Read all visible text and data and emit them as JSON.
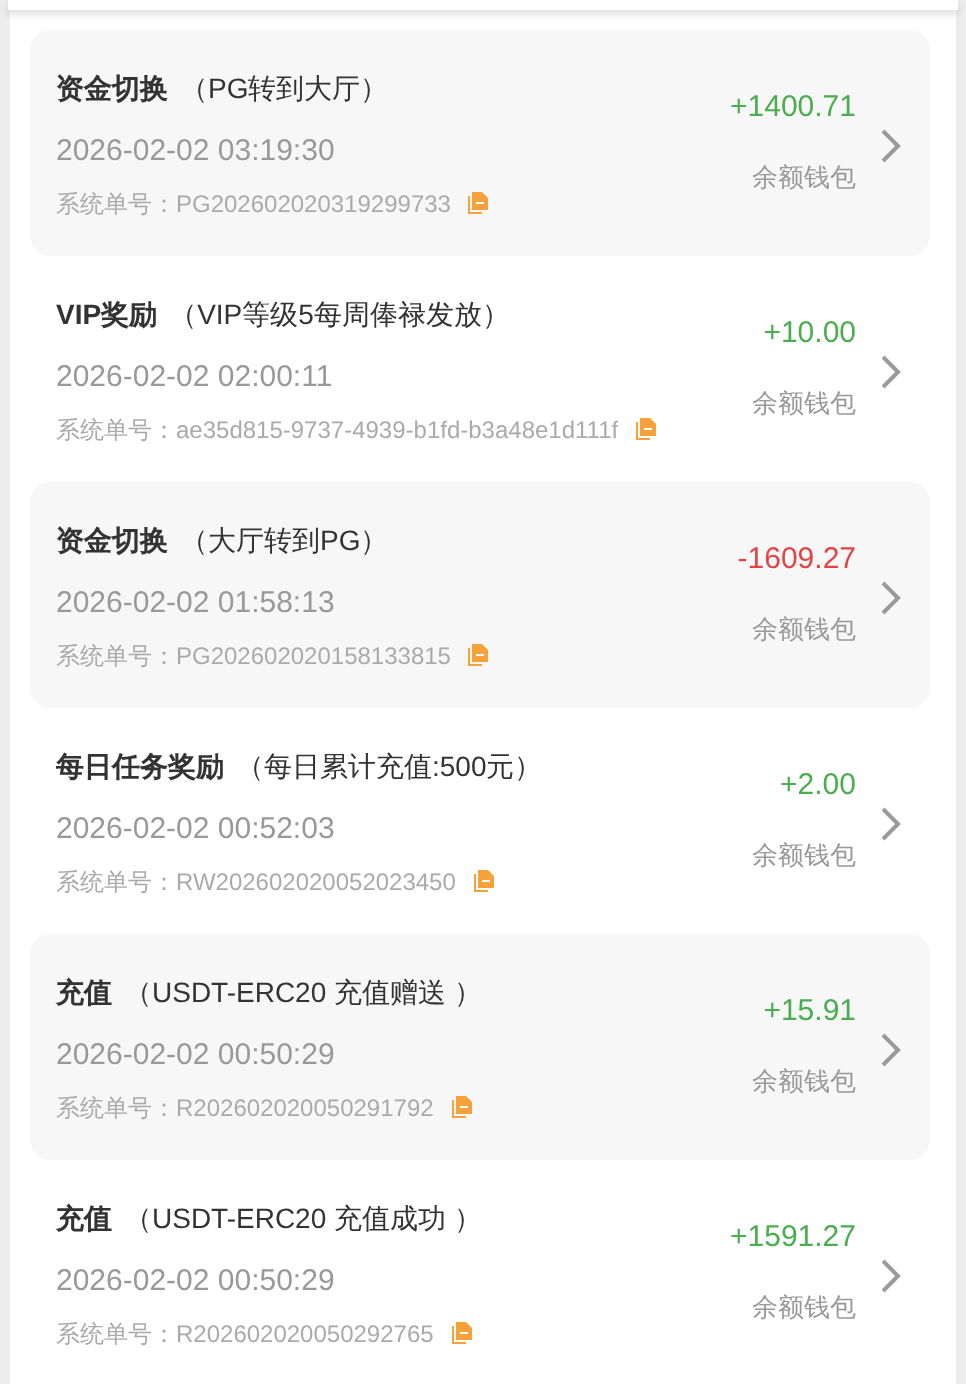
{
  "records": [
    {
      "name": "资金切换",
      "detail": "（PG转到大厅）",
      "time": "2026-02-02 03:19:30",
      "order": "系统单号：PG202602020319299733",
      "amount": "+1400.71",
      "kind": "credit",
      "wallet": "余额钱包"
    },
    {
      "name": "VIP奖励",
      "detail": "（VIP等级5每周俸禄发放）",
      "time": "2026-02-02 02:00:11",
      "order": "系统单号：ae35d815-9737-4939-b1fd-b3a48e1d111f",
      "amount": "+10.00",
      "kind": "credit",
      "wallet": "余额钱包"
    },
    {
      "name": "资金切换",
      "detail": "（大厅转到PG）",
      "time": "2026-02-02 01:58:13",
      "order": "系统单号：PG202602020158133815",
      "amount": "-1609.27",
      "kind": "debit",
      "wallet": "余额钱包"
    },
    {
      "name": "每日任务奖励",
      "detail": "（每日累计充值:500元）",
      "time": "2026-02-02 00:52:03",
      "order": "系统单号：RW202602020052023450",
      "amount": "+2.00",
      "kind": "credit",
      "wallet": "余额钱包"
    },
    {
      "name": "充值",
      "detail": "（USDT-ERC20 充值赠送 ）",
      "time": "2026-02-02 00:50:29",
      "order": "系统单号：R202602020050291792",
      "amount": "+15.91",
      "kind": "credit",
      "wallet": "余额钱包"
    },
    {
      "name": "充值",
      "detail": "（USDT-ERC20 充值成功 ）",
      "time": "2026-02-02 00:50:29",
      "order": "系统单号：R202602020050292765",
      "amount": "+1591.27",
      "kind": "credit",
      "wallet": "余额钱包"
    }
  ]
}
